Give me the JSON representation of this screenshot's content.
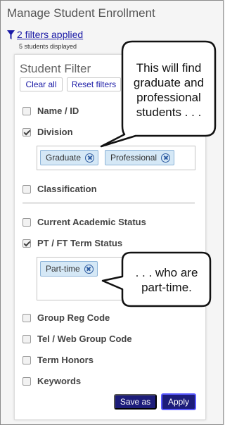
{
  "header": {
    "title": "Manage Student Enrollment",
    "filters_link": "2 filters applied",
    "students_displayed": "5 students displayed",
    "funnel_icon": "funnel-icon"
  },
  "panel": {
    "title": "Student Filter",
    "clear_all": "Clear all",
    "reset_filters": "Reset filters",
    "filters": [
      {
        "label": "Name / ID",
        "checked": false
      },
      {
        "label": "Division",
        "checked": true
      },
      {
        "label": "Classification",
        "checked": false
      },
      {
        "label": "Current Academic Status",
        "checked": false
      },
      {
        "label": "PT / FT Term Status",
        "checked": true
      },
      {
        "label": "Group Reg Code",
        "checked": false
      },
      {
        "label": "Tel / Web Group Code",
        "checked": false
      },
      {
        "label": "Term Honors",
        "checked": false
      },
      {
        "label": "Keywords",
        "checked": false
      }
    ],
    "division_chips": [
      "Graduate",
      "Professional"
    ],
    "term_status_chips": [
      "Part-time"
    ],
    "save_as": "Save as",
    "apply": "Apply"
  },
  "callouts": {
    "top_lines": [
      "This will find",
      "graduate and",
      "professional",
      "students . . ."
    ],
    "bottom_lines": [
      ". . . who are",
      "part-time."
    ]
  },
  "colors": {
    "link": "#1a1aa6",
    "chip_bg": "#d5e8f6",
    "button_dark": "#1c1c7a"
  }
}
